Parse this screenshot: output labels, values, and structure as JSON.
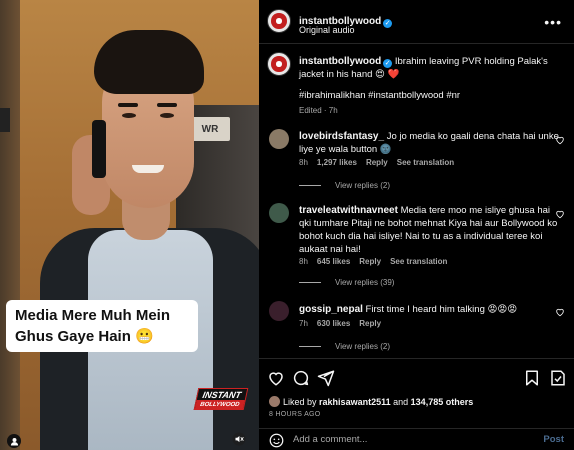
{
  "video": {
    "caption_line1": "Media Mere Muh Mein",
    "caption_line2": "Ghus Gaye Hain",
    "door_sign": "WR",
    "watermark_top": "INSTANT",
    "watermark_bottom": "BOLLYWOOD"
  },
  "header": {
    "username": "instantbollywood",
    "subtitle": "Original audio",
    "more": "•••"
  },
  "post": {
    "username": "instantbollywood",
    "caption": "Ibrahim leaving PVR holding Palak's jacket in his hand 😍 ❤️",
    "dot": ".",
    "hashtags": "#ibrahimalikhan #instantbollywood #nr",
    "edited": "Edited · 7h"
  },
  "comments": [
    {
      "username": "lovebirdsfantasy_",
      "text": "Jo jo media ko gaali dena chata hai unke liye ye wala button 🌚",
      "time": "8h",
      "likes": "1,297 likes",
      "reply": "Reply",
      "translate": "See translation",
      "view_replies": "View replies (2)",
      "avatar_color": "#8a7a66"
    },
    {
      "username": "traveleatwithnavneet",
      "text": "Media tere moo me isliye ghusa hai qki tumhare Pitaji ne bohot mehnat Kiya hai aur Bollywood ko bohot kuch dia hai isliye! Nai to tu as a individual teree koi aukaat nai hai!",
      "time": "8h",
      "likes": "645 likes",
      "reply": "Reply",
      "translate": "See translation",
      "view_replies": "View replies (39)",
      "avatar_color": "#3f5a4a"
    },
    {
      "username": "gossip_nepal",
      "text": "First time I heard him talking 😡😡😡",
      "time": "7h",
      "likes": "630 likes",
      "reply": "Reply",
      "view_replies": "View replies (2)",
      "avatar_color": "#3a1f2c"
    }
  ],
  "footer": {
    "liked_by_prefix": "Liked by",
    "liked_by_user": "rakhisawant2511",
    "liked_by_and": "and",
    "liked_by_others": "134,785 others",
    "timestamp": "8 HOURS AGO",
    "comment_placeholder": "Add a comment...",
    "post_label": "Post"
  }
}
